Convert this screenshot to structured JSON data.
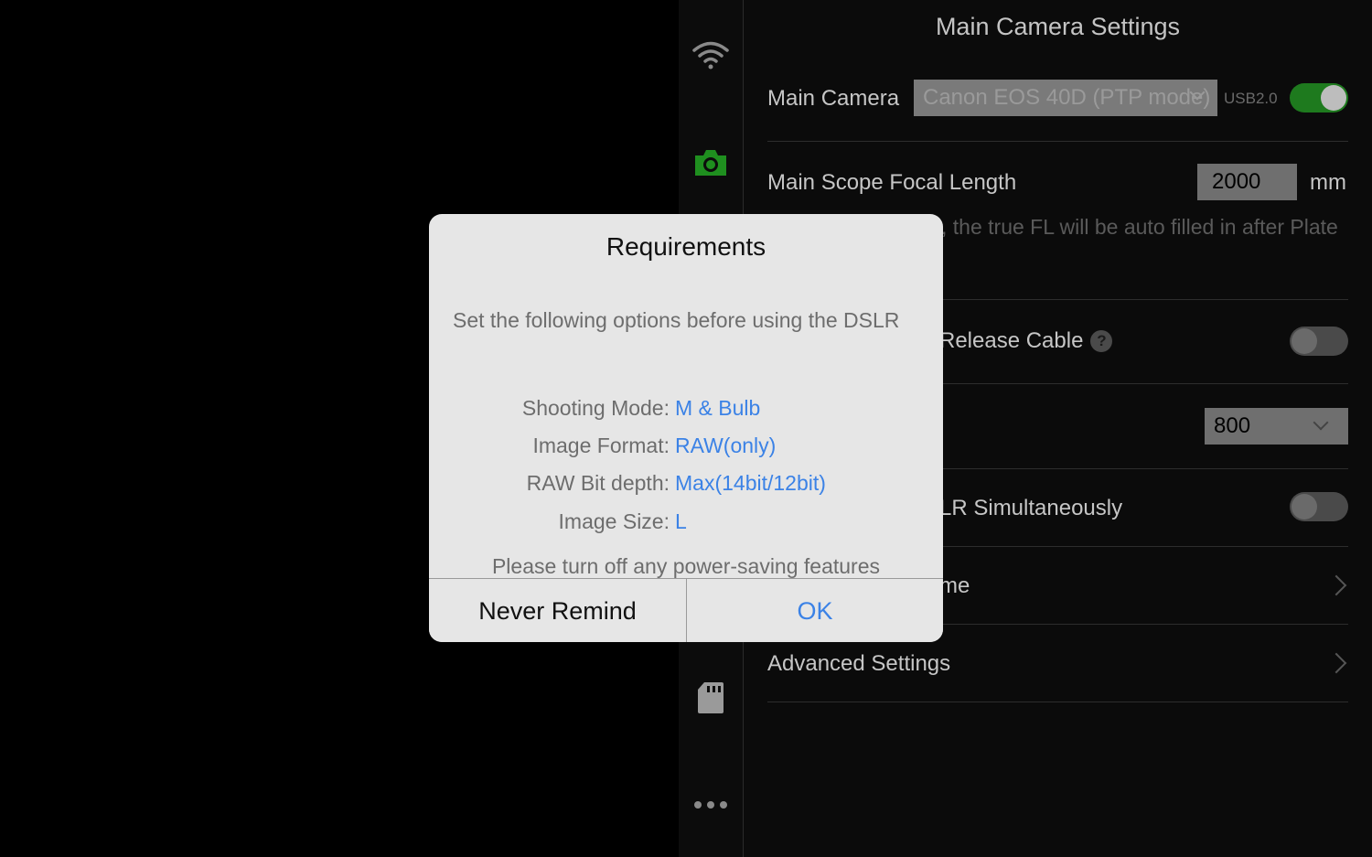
{
  "panel": {
    "title": "Main Camera Settings",
    "main_camera": {
      "label": "Main Camera",
      "selected": "Canon EOS 40D (PTP mode)",
      "usb_label": "USB2.0",
      "enabled": true
    },
    "focal_length": {
      "label": "Main Scope Focal Length",
      "value": "2000",
      "unit": "mm",
      "hint": ", the true FL will be auto filled in after Plate"
    },
    "release_cable": {
      "label": "Release Cable",
      "help": "?",
      "enabled": false
    },
    "iso": {
      "value": "800"
    },
    "simultaneous": {
      "label": "LR Simultaneously",
      "enabled": false
    },
    "name_row": {
      "label": "me"
    },
    "advanced": {
      "label": "Advanced Settings"
    }
  },
  "rail": {
    "icons": [
      "wifi-icon",
      "camera-icon",
      "sd-card-icon",
      "more-icon"
    ]
  },
  "modal": {
    "title": "Requirements",
    "message": "Set the following options before using the DSLR",
    "requirements": [
      {
        "key": "Shooting Mode:",
        "value": "M & Bulb"
      },
      {
        "key": "Image Format:",
        "value": "RAW(only)"
      },
      {
        "key": "RAW Bit depth:",
        "value": "Max(14bit/12bit)"
      },
      {
        "key": "Image Size:",
        "value": "L"
      }
    ],
    "note": "Please turn off any power-saving features",
    "never_remind_label": "Never Remind",
    "ok_label": "OK"
  },
  "colors": {
    "accent_green": "#1e7a1e",
    "link_blue": "#3b82e6",
    "modal_bg": "#e6e6e6"
  }
}
